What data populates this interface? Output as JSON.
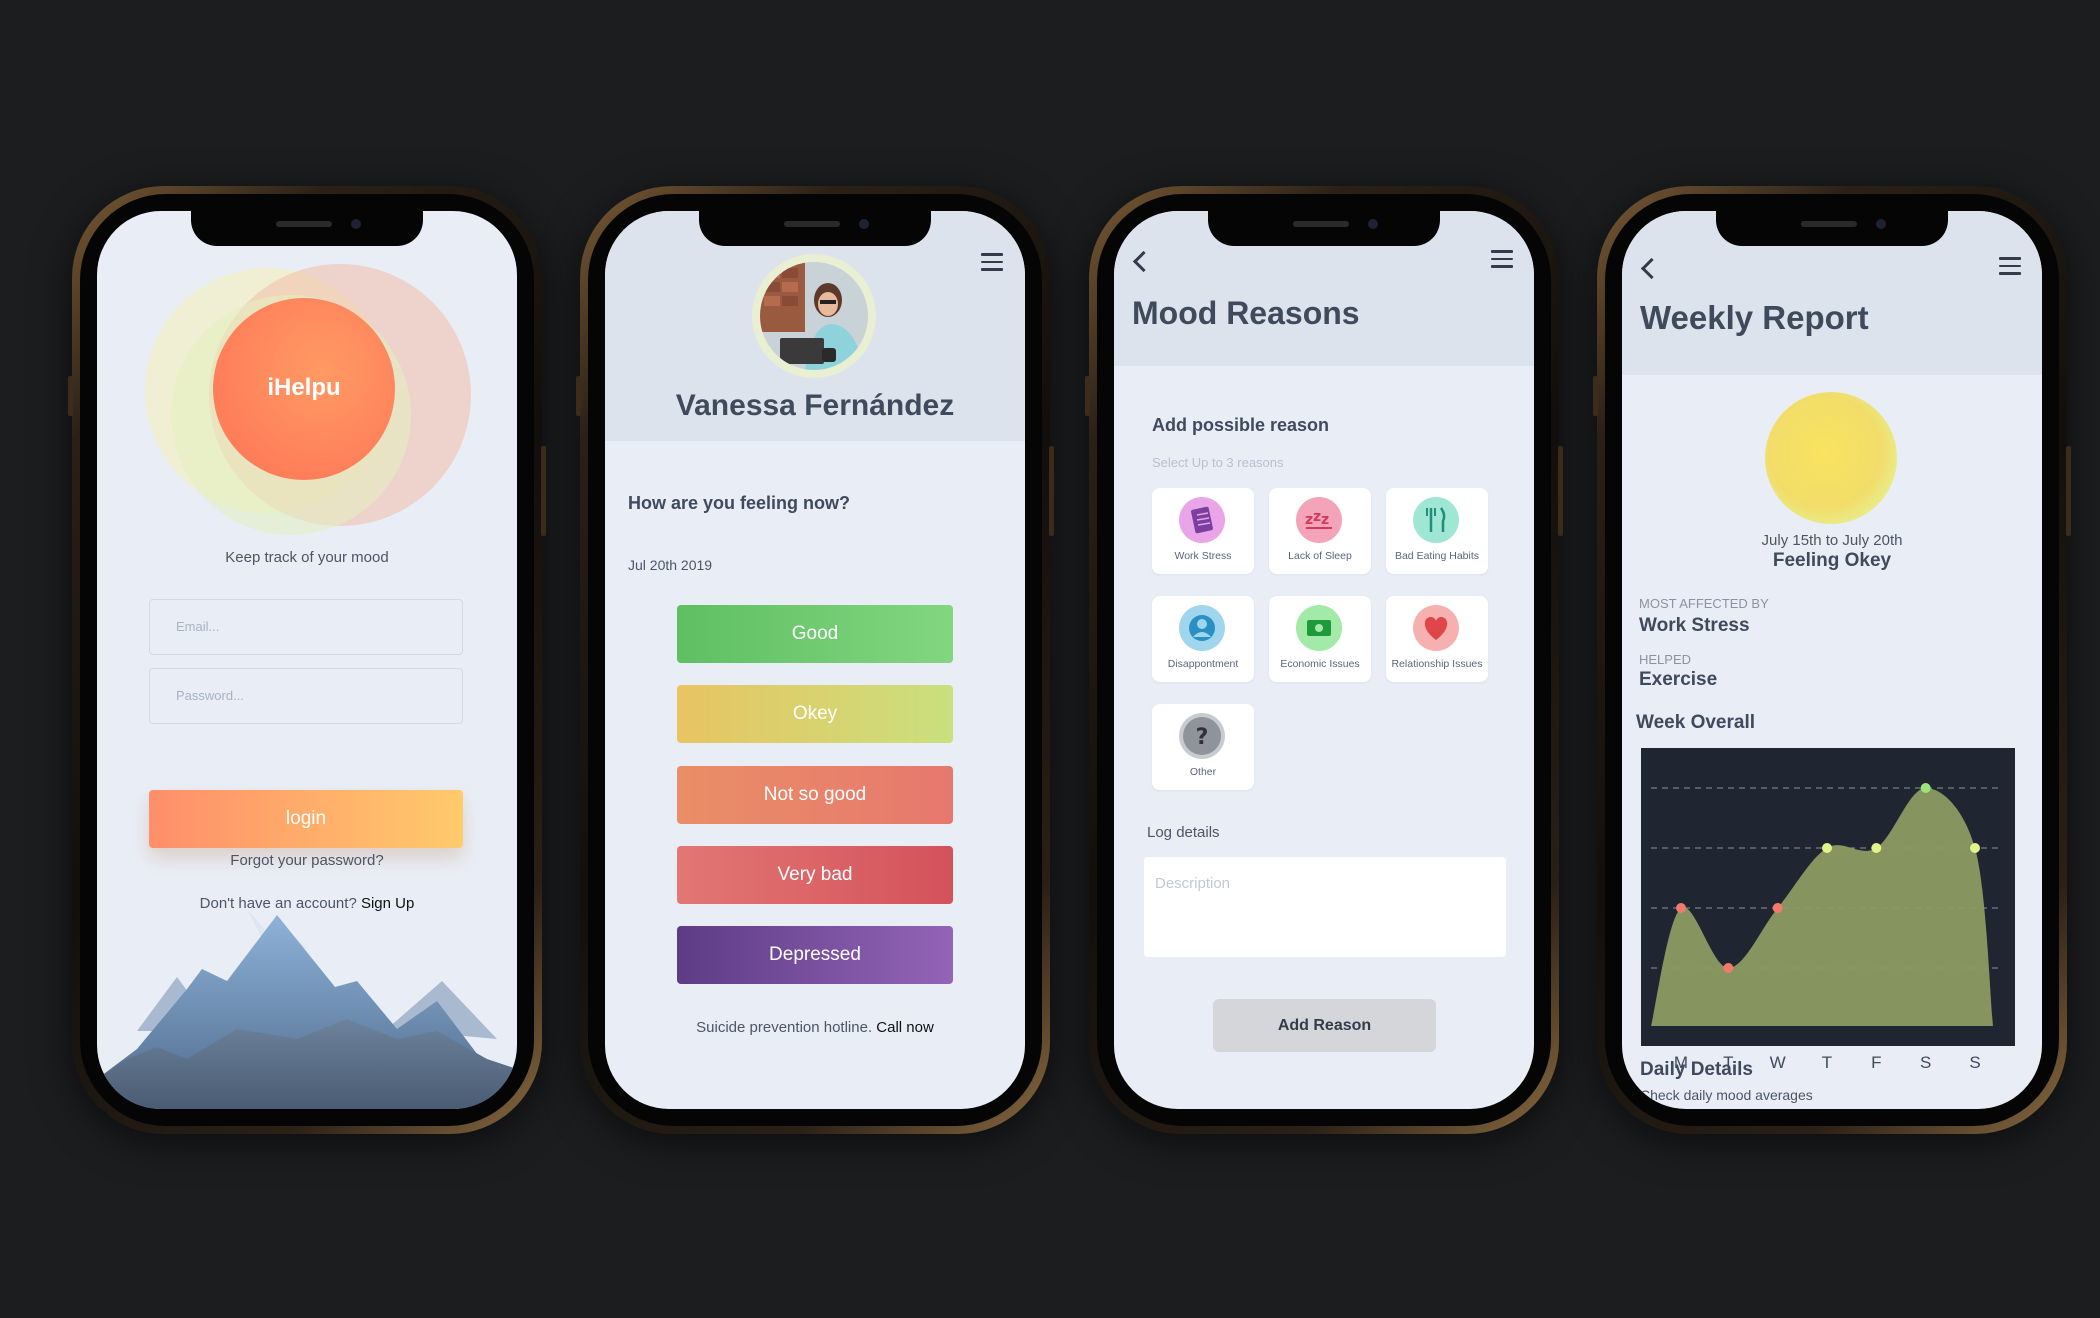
{
  "login": {
    "app_name": "iHelpu",
    "tagline": "Keep track of your mood",
    "email_placeholder": "Email...",
    "password_placeholder": "Password...",
    "login_label": "login",
    "forgot": "Forgot your password?",
    "no_account": "Don't have an account?",
    "signup": "Sign Up"
  },
  "mood": {
    "user_name": "Vanessa Fernández",
    "question": "How are you feeling now?",
    "date": "Jul 20th 2019",
    "options": [
      "Good",
      "Okey",
      "Not so good",
      "Very bad",
      "Depressed"
    ],
    "hotline_text": "Suicide prevention hotline.",
    "hotline_link": "Call now"
  },
  "reasons": {
    "title": "Mood Reasons",
    "add_heading": "Add possible reason",
    "hint": "Select Up to 3 reasons",
    "items": [
      "Work Stress",
      "Lack of Sleep",
      "Bad Eating Habits",
      "Disappontment",
      "Economic Issues",
      "Relationship Issues",
      "Other"
    ],
    "icons": [
      "notebook-icon",
      "sleep-zzz-icon",
      "fork-knife-icon",
      "person-icon",
      "money-icon",
      "heart-icon",
      "question-icon"
    ],
    "log_label": "Log details",
    "description_placeholder": "Description",
    "add_button": "Add Reason"
  },
  "report": {
    "title": "Weekly Report",
    "range": "July 15th to July 20th",
    "feeling": "Feeling Okey",
    "most_affected_label": "MOST AFFECTED BY",
    "most_affected_value": "Work Stress",
    "helped_label": "HELPED",
    "helped_value": "Exercise",
    "week_overall": "Week Overall",
    "daily_title": "Daily Details",
    "daily_sub": "Check daily mood averages"
  },
  "chart_data": {
    "type": "area",
    "categories": [
      "M",
      "T",
      "W",
      "T",
      "F",
      "S",
      "S"
    ],
    "values": [
      2,
      1,
      2,
      3,
      3,
      4,
      3
    ],
    "ylim": [
      0,
      4.5
    ],
    "grid": true,
    "point_colors": [
      "#f27a6a",
      "#f27a6a",
      "#f27a6a",
      "#e3f28a",
      "#e3f28a",
      "#9be37a",
      "#e3f28a"
    ],
    "fill_color": "#8c9a63",
    "background": "#1f2631"
  },
  "colors": {
    "good": "#6ccd73",
    "okey": "#d8d772",
    "not_so_good": "#e8856a",
    "very_bad": "#db5f64",
    "depressed": "#7a4b9c"
  }
}
